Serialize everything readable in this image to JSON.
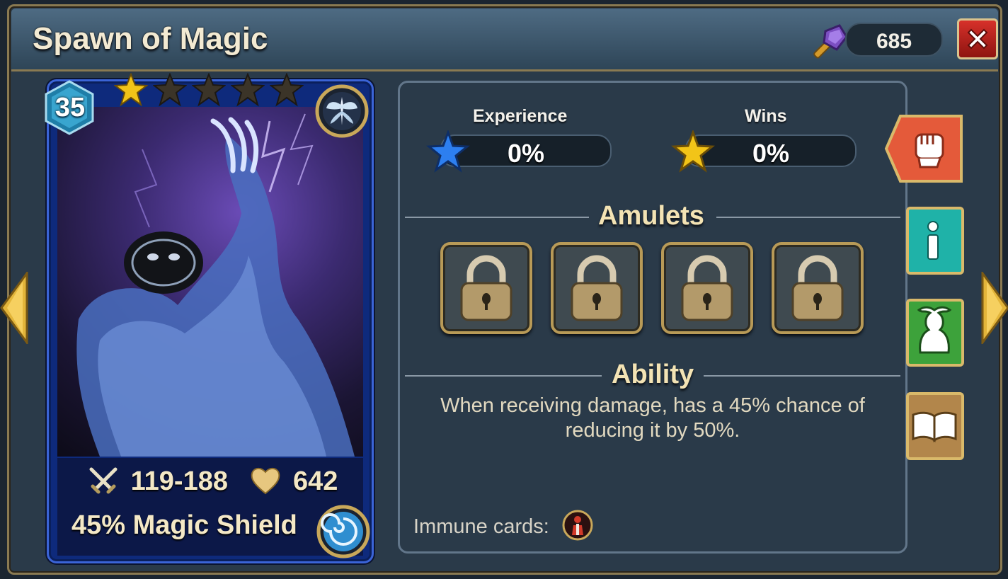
{
  "window": {
    "title": "Spawn of Magic",
    "close_icon": "close-icon"
  },
  "currency": {
    "value": "685",
    "icon": "purple-hammer-icon"
  },
  "navigation": {
    "prev_icon": "arrow-left-icon",
    "next_icon": "arrow-right-icon"
  },
  "card": {
    "level": "35",
    "stars_total": 5,
    "stars_filled": 1,
    "attack": "119-188",
    "health": "642",
    "ability_short": "45% Magic Shield",
    "class_icon": "fairy-emblem-icon",
    "element_icon": "water-swirl-icon"
  },
  "progress": {
    "experience_label": "Experience",
    "experience_value": "0%",
    "wins_label": "Wins",
    "wins_value": "0%"
  },
  "amulets": {
    "heading": "Amulets",
    "slots": [
      {
        "state": "locked"
      },
      {
        "state": "locked"
      },
      {
        "state": "locked"
      },
      {
        "state": "locked"
      }
    ]
  },
  "ability": {
    "heading": "Ability",
    "description": "When receiving damage, has a 45% chance of reducing it by 50%."
  },
  "immune": {
    "label": "Immune cards:"
  },
  "side_tabs": [
    {
      "name": "fight",
      "icon": "fist-icon",
      "color": "#e45a3a"
    },
    {
      "name": "info",
      "icon": "info-icon",
      "color": "#1fb2a8"
    },
    {
      "name": "creature",
      "icon": "monster-icon",
      "color": "#3da23b"
    },
    {
      "name": "book",
      "icon": "book-icon",
      "color": "#b2864b"
    }
  ],
  "colors": {
    "accent_gold": "#d9c48e",
    "close_red": "#d7312a",
    "panel_bg": "#2a3a49",
    "card_blue": "#3b64d7"
  }
}
